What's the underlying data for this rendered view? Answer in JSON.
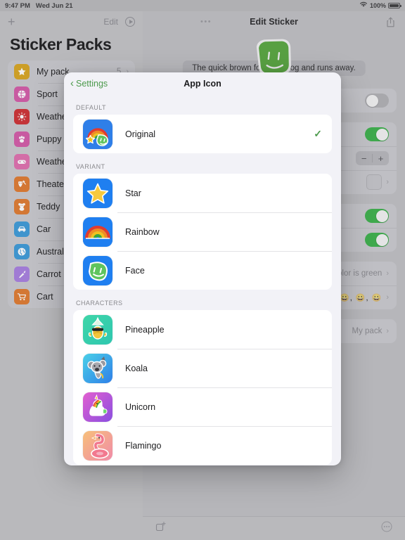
{
  "status_bar": {
    "time": "9:47 PM",
    "date": "Wed Jun 21",
    "battery_pct": "100%",
    "wifi_icon": "wifi-icon"
  },
  "sidebar": {
    "add_label": "+",
    "edit_label": "Edit",
    "play_icon": "play-circle-icon",
    "title": "Sticker Packs",
    "items": [
      {
        "label": "My pack",
        "count": "5",
        "chevron": "›",
        "icon": "star-icon",
        "glyph": "★",
        "color": "#d9a520"
      },
      {
        "label": "Sport",
        "count": "",
        "chevron": "",
        "icon": "ball-icon",
        "glyph": "◕",
        "color": "#d45aa8"
      },
      {
        "label": "Weather",
        "count": "",
        "chevron": "",
        "icon": "sun-icon",
        "glyph": "☀",
        "color": "#cf2f33"
      },
      {
        "label": "Puppy",
        "count": "",
        "chevron": "",
        "icon": "paw-icon",
        "glyph": "✿",
        "color": "#d45aa8"
      },
      {
        "label": "Weather",
        "count": "",
        "chevron": "",
        "icon": "gamepad-icon",
        "glyph": "▬",
        "color": "#e06fae"
      },
      {
        "label": "Theater",
        "count": "",
        "chevron": "",
        "icon": "masks-icon",
        "glyph": "⚔",
        "color": "#e07a2e"
      },
      {
        "label": "Teddy",
        "count": "",
        "chevron": "",
        "icon": "bear-icon",
        "glyph": "◉",
        "color": "#e07a2e"
      },
      {
        "label": "Car",
        "count": "",
        "chevron": "",
        "icon": "car-icon",
        "glyph": "▬",
        "color": "#3c9ad9"
      },
      {
        "label": "Australia",
        "count": "",
        "chevron": "",
        "icon": "globe-icon",
        "glyph": "○",
        "color": "#3c9ad9"
      },
      {
        "label": "Carrot",
        "count": "",
        "chevron": "",
        "icon": "carrot-icon",
        "glyph": "✒",
        "color": "#a77ee0"
      },
      {
        "label": "Cart",
        "count": "",
        "chevron": "",
        "icon": "cart-icon",
        "glyph": "⛟",
        "color": "#e07a2e"
      }
    ]
  },
  "detail": {
    "more_icon": "more-dots-icon",
    "title": "Edit Sticker",
    "share_icon": "share-icon",
    "caption": "The quick brown fox ju    zy dog and runs away.",
    "sticker_icon": "green-face-sticker",
    "rows": [
      {
        "label": "",
        "type": "toggle",
        "on": false
      },
      {
        "label": "",
        "type": "toggle",
        "on": true
      },
      {
        "label": "",
        "type": "stepper",
        "minus": "−",
        "plus": "+"
      },
      {
        "label": "",
        "type": "swatch",
        "chevron": "›"
      },
      {
        "label": "",
        "type": "toggle",
        "on": true
      },
      {
        "label": "",
        "type": "toggle",
        "on": true
      },
      {
        "label": "",
        "type": "value",
        "value": "color is green",
        "chevron": "›"
      },
      {
        "label": "",
        "type": "emoji",
        "value": "😀, 😀, 😀",
        "chevron": "›"
      },
      {
        "label": "",
        "type": "value",
        "value": "My pack",
        "chevron": "›"
      }
    ]
  },
  "bottom_bar": {
    "add_sticker_icon": "add-sticker-icon",
    "more_icon": "more-circle-icon"
  },
  "modal": {
    "back_label": "Settings",
    "back_icon": "chevron-left-icon",
    "title": "App Icon",
    "accent_color": "#4c9a4c",
    "sections": [
      {
        "header": "DEFAULT",
        "items": [
          {
            "label": "Original",
            "icon": "original-app-icon",
            "selected": true,
            "check": "✓"
          }
        ]
      },
      {
        "header": "VARIANT",
        "items": [
          {
            "label": "Star",
            "icon": "star-app-icon",
            "selected": false,
            "check": ""
          },
          {
            "label": "Rainbow",
            "icon": "rainbow-app-icon",
            "selected": false,
            "check": ""
          },
          {
            "label": "Face",
            "icon": "face-app-icon",
            "selected": false,
            "check": ""
          }
        ]
      },
      {
        "header": "CHARACTERS",
        "items": [
          {
            "label": "Pineapple",
            "icon": "pineapple-app-icon",
            "selected": false,
            "check": ""
          },
          {
            "label": "Koala",
            "icon": "koala-app-icon",
            "selected": false,
            "check": ""
          },
          {
            "label": "Unicorn",
            "icon": "unicorn-app-icon",
            "selected": false,
            "check": ""
          },
          {
            "label": "Flamingo",
            "icon": "flamingo-app-icon",
            "selected": false,
            "check": ""
          }
        ]
      }
    ]
  }
}
